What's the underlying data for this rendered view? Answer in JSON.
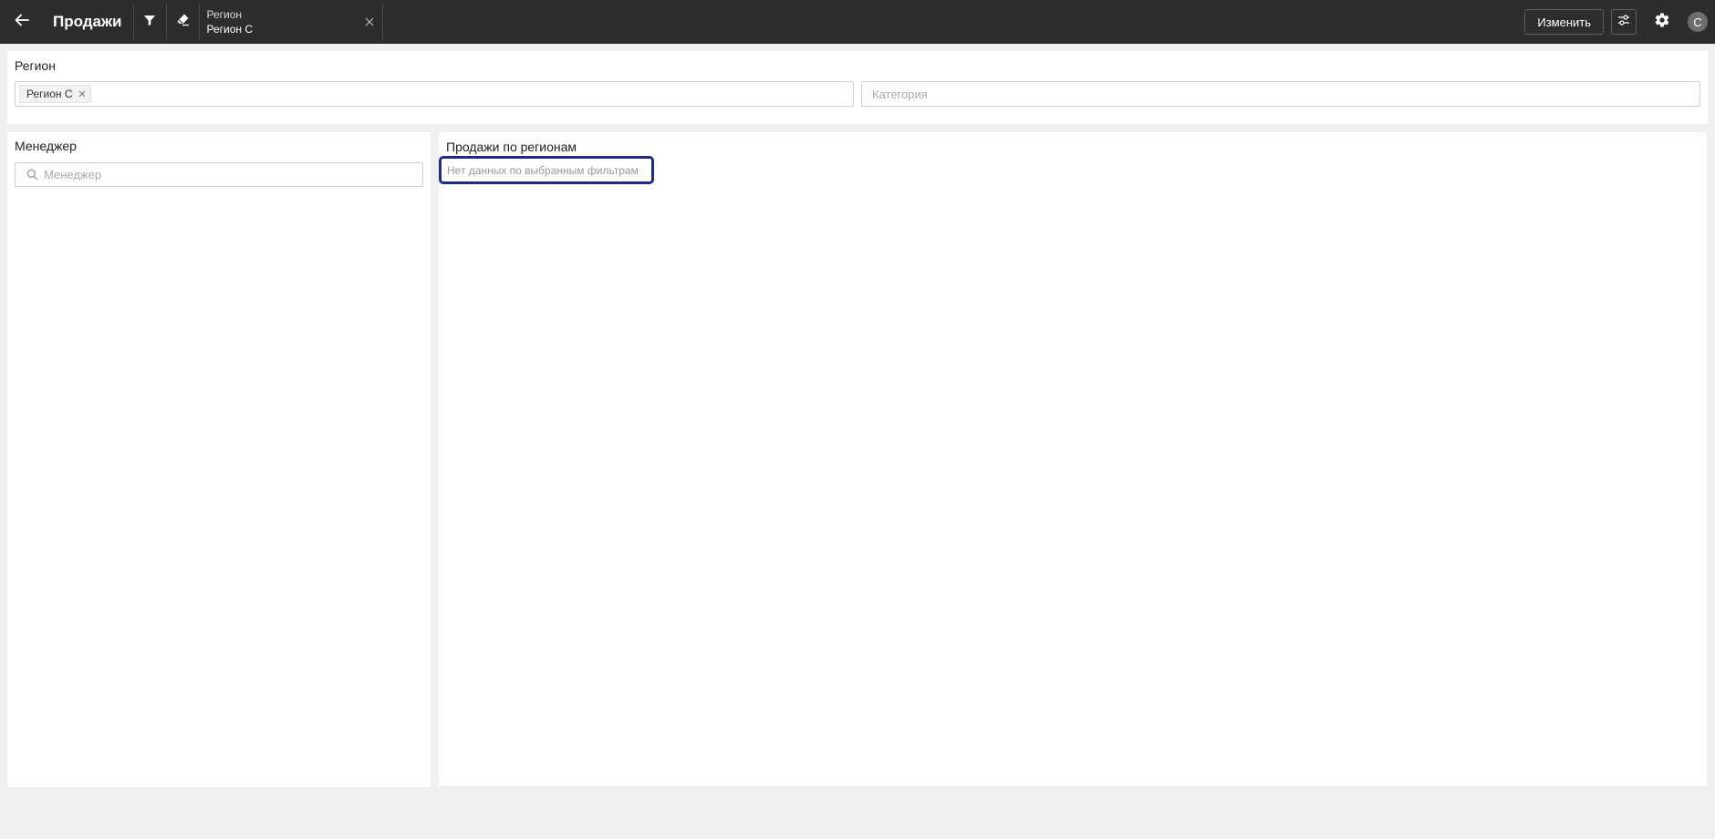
{
  "topbar": {
    "back_icon": "arrow-left-icon",
    "title": "Продажи",
    "filter_icon": "funnel-icon",
    "clear_icon": "eraser-icon",
    "active_filter": {
      "label": "Регион",
      "value": "Регион С",
      "close_icon": "close-icon"
    },
    "edit_label": "Изменить",
    "sliders_icon": "sliders-icon",
    "settings_icon": "gear-icon",
    "avatar_letter": "С"
  },
  "filters": {
    "title": "Регион",
    "region_select": {
      "selected_tags": [
        "Регион С"
      ]
    },
    "category_select": {
      "placeholder": "Категория"
    }
  },
  "manager_panel": {
    "title": "Менеджер",
    "search_placeholder": "Менеджер"
  },
  "chart_panel": {
    "title": "Продажи по регионам",
    "empty_message": "Нет данных по выбранным фильтрам"
  },
  "colors": {
    "topbar_bg": "#2d2d2d",
    "page_bg": "#efefef",
    "focus_outline": "#1d2c8a"
  }
}
